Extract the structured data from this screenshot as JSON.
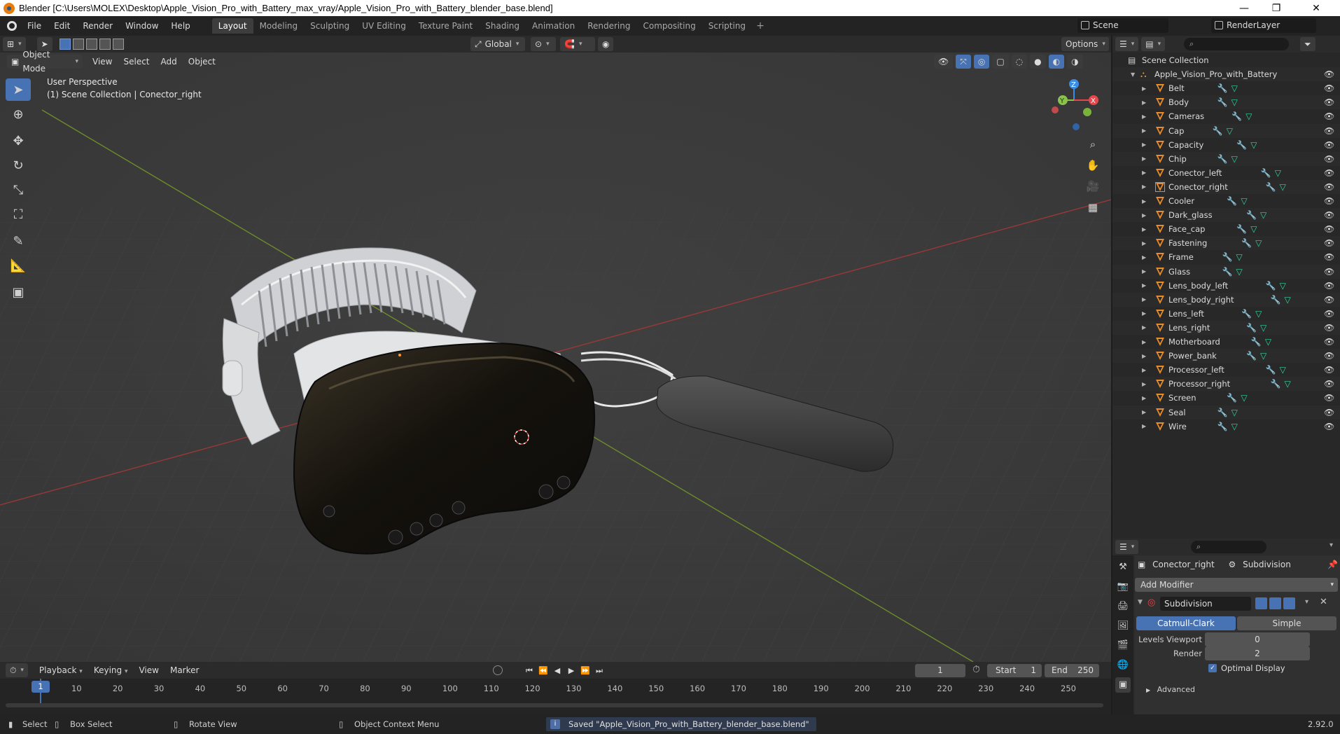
{
  "window": {
    "title": "Blender [C:\\Users\\MOLEX\\Desktop\\Apple_Vision_Pro_with_Battery_max_vray/Apple_Vision_Pro_with_Battery_blender_base.blend]",
    "minimize": "—",
    "maximize": "❐",
    "close": "✕"
  },
  "menu": [
    "File",
    "Edit",
    "Render",
    "Window",
    "Help"
  ],
  "workspaces": [
    {
      "label": "Layout",
      "active": true
    },
    {
      "label": "Modeling",
      "active": false
    },
    {
      "label": "Sculpting",
      "active": false
    },
    {
      "label": "UV Editing",
      "active": false
    },
    {
      "label": "Texture Paint",
      "active": false
    },
    {
      "label": "Shading",
      "active": false
    },
    {
      "label": "Animation",
      "active": false
    },
    {
      "label": "Rendering",
      "active": false
    },
    {
      "label": "Compositing",
      "active": false
    },
    {
      "label": "Scripting",
      "active": false
    }
  ],
  "workspace_add": "+",
  "scene": {
    "label": "Scene",
    "render_layer": "RenderLayer"
  },
  "viewport_header": {
    "transform_orientation": "Global",
    "options": "Options",
    "mode": "Object Mode",
    "menus": [
      "View",
      "Select",
      "Add",
      "Object"
    ]
  },
  "viewport": {
    "perspective": "User Perspective",
    "collection_info": "(1) Scene Collection | Conector_right",
    "gizmo": {
      "x": "X",
      "y": "Y",
      "z": "Z"
    }
  },
  "outliner": {
    "root": "Scene Collection",
    "collection": "Apple_Vision_Pro_with_Battery",
    "objects": [
      "Belt",
      "Body",
      "Cameras",
      "Cap",
      "Capacity",
      "Chip",
      "Conector_left",
      "Conector_right",
      "Cooler",
      "Dark_glass",
      "Face_cap",
      "Fastening",
      "Frame",
      "Glass",
      "Lens_body_left",
      "Lens_body_right",
      "Lens_left",
      "Lens_right",
      "Motherboard",
      "Power_bank",
      "Processor_left",
      "Processor_right",
      "Screen",
      "Seal",
      "Wire"
    ],
    "active_object": "Conector_right"
  },
  "properties": {
    "object_name": "Conector_right",
    "modifier_breadcrumb": "Subdivision",
    "add_modifier": "Add Modifier",
    "modifier": {
      "name": "Subdivision",
      "method_catmull": "Catmull-Clark",
      "method_simple": "Simple",
      "levels_viewport_label": "Levels Viewport",
      "levels_viewport": "0",
      "render_label": "Render",
      "render_levels": "2",
      "optimal_display": "Optimal Display",
      "advanced": "Advanced"
    }
  },
  "timeline": {
    "menus": [
      "Playback",
      "Keying",
      "View",
      "Marker"
    ],
    "current_frame": "1",
    "start_label": "Start",
    "start": "1",
    "end_label": "End",
    "end": "250",
    "ticks": [
      "1",
      "10",
      "20",
      "30",
      "40",
      "50",
      "60",
      "70",
      "80",
      "90",
      "100",
      "110",
      "120",
      "130",
      "140",
      "150",
      "160",
      "170",
      "180",
      "190",
      "200",
      "210",
      "220",
      "230",
      "240",
      "250"
    ]
  },
  "status": {
    "select": "Select",
    "box_select": "Box Select",
    "rotate_view": "Rotate View",
    "context_menu": "Object Context Menu",
    "message": "Saved \"Apple_Vision_Pro_with_Battery_blender_base.blend\"",
    "version": "2.92.0"
  },
  "colors": {
    "accent": "#4772b3",
    "object_orange": "#e88c2c",
    "x_axis": "#e5474d",
    "y_axis": "#8bc34a",
    "z_axis": "#3b8ce6"
  }
}
